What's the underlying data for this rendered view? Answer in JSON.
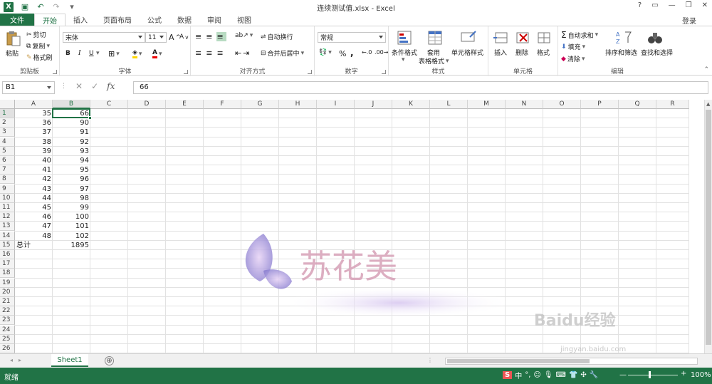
{
  "window": {
    "title": "连续测试值.xlsx - Excel",
    "help": "?",
    "login": "登录"
  },
  "tabs": [
    "文件",
    "开始",
    "插入",
    "页面布局",
    "公式",
    "数据",
    "审阅",
    "视图"
  ],
  "ribbon": {
    "clipboard": {
      "paste": "粘贴",
      "cut": "剪切",
      "copy": "复制",
      "format_painter": "格式刷",
      "label": "剪贴板"
    },
    "font": {
      "name": "宋体",
      "size": "11",
      "grow": "A",
      "shrink": "A",
      "bold": "B",
      "italic": "I",
      "underline": "U",
      "color_letter": "A",
      "label": "字体"
    },
    "alignment": {
      "wrap": "自动换行",
      "merge": "合并后居中",
      "label": "对齐方式"
    },
    "number": {
      "format": "常规",
      "percent": "%",
      "comma": ",",
      "label": "数字"
    },
    "styles": {
      "conditional": "条件格式",
      "table1": "套用",
      "table2": "表格格式",
      "cell_styles": "单元格样式",
      "label": "样式"
    },
    "cells": {
      "insert": "插入",
      "delete": "删除",
      "format": "格式",
      "label": "单元格"
    },
    "editing": {
      "autosum": "自动求和",
      "fill": "填充",
      "clear": "清除",
      "sort": "排序和筛选",
      "find": "查找和选择",
      "label": "编辑"
    }
  },
  "formula_bar": {
    "name_box": "B1",
    "fx": "fx",
    "value": "66"
  },
  "columns": [
    "A",
    "B",
    "C",
    "D",
    "E",
    "F",
    "G",
    "H",
    "I",
    "J",
    "K",
    "L",
    "M",
    "N",
    "O",
    "P",
    "Q",
    "R"
  ],
  "rows": [
    "1",
    "2",
    "3",
    "4",
    "5",
    "6",
    "7",
    "8",
    "9",
    "10",
    "11",
    "12",
    "13",
    "14",
    "15",
    "16",
    "17",
    "18",
    "19",
    "20",
    "21",
    "22",
    "23",
    "24",
    "25",
    "26"
  ],
  "cells": [
    [
      "35",
      "66"
    ],
    [
      "36",
      "90"
    ],
    [
      "37",
      "91"
    ],
    [
      "38",
      "92"
    ],
    [
      "39",
      "93"
    ],
    [
      "40",
      "94"
    ],
    [
      "41",
      "95"
    ],
    [
      "42",
      "96"
    ],
    [
      "43",
      "97"
    ],
    [
      "44",
      "98"
    ],
    [
      "45",
      "99"
    ],
    [
      "46",
      "100"
    ],
    [
      "47",
      "101"
    ],
    [
      "48",
      "102"
    ]
  ],
  "total_row": {
    "label": "总计",
    "value": "1895"
  },
  "sheet_tab": "Sheet1",
  "add_sheet": "⊕",
  "status": {
    "ready": "就绪",
    "zoom": "100%",
    "ime": "中"
  },
  "watermark": {
    "brand": "苏花美",
    "baidu": "Baidu经验",
    "baidu_url": "jingyan.baidu.com"
  }
}
